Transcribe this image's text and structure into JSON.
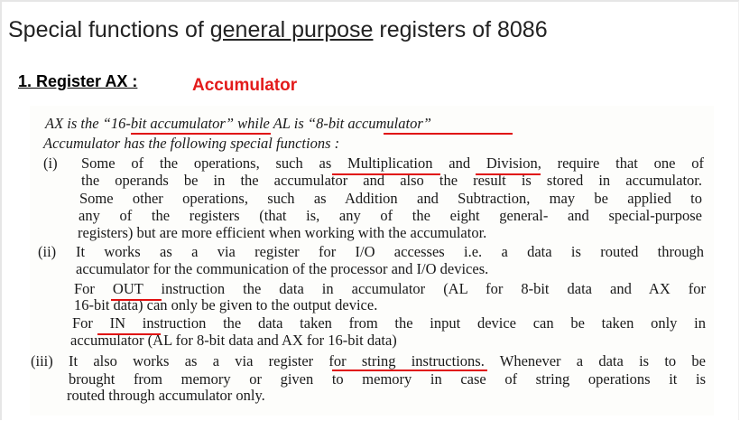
{
  "title": {
    "part1": "Special functions of ",
    "underlined": "general purpose",
    "part2": " registers of 8086"
  },
  "heading": "1. Register AX :",
  "subheading": "Accumulator",
  "accent_color": "#e31b1b",
  "text": {
    "l1": "AX is the “16-bit accumulator” while AL is “8-bit accumulator”",
    "l2": "Accumulator has the following special functions :",
    "n1": "(i)",
    "l3": "Some of the operations, such as Multiplication and Division, require that one of",
    "l4": "the operands be in the accumulator and also the result is stored in accumulator.",
    "l5": "Some other operations, such as Addition and Subtraction, may be applied to",
    "l6": "any of the registers (that is, any of the eight general- and special-purpose",
    "l7": "registers) but are more efficient when working with the accumulator.",
    "n2": "(ii)",
    "l8": "It works as a via register for I/O accesses i.e. a data is routed through",
    "l9": "accumulator for the communication of the processor and I/O devices.",
    "l10": "For OUT instruction the data in accumulator (AL for 8-bit data and AX for",
    "l11": "16-bit data) can only be given to the output device.",
    "l12": "For IN instruction the data taken from the input device can be taken only in",
    "l13": "accumulator (AL for 8-bit data and AX for 16-bit data)",
    "n3": "(iii)",
    "l14": "It also works as a via register for string instructions. Whenever a data is to be",
    "l15": "brought from memory or given to memory in case of string operations it is",
    "l16": "routed through accumulator only."
  }
}
